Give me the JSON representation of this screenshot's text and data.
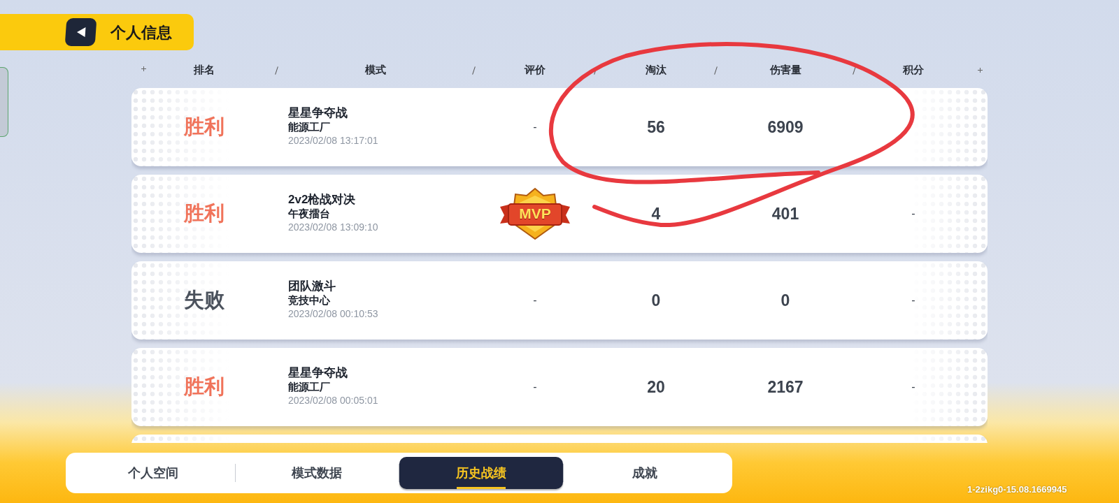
{
  "header": {
    "title": "个人信息"
  },
  "columns": [
    "排名",
    "模式",
    "评价",
    "淘汰",
    "伤害量",
    "积分"
  ],
  "rows": [
    {
      "result": "胜利",
      "kind": "win",
      "mode": "星星争夺战",
      "map": "能源工厂",
      "time": "2023/02/08 13:17:01",
      "rating": {
        "kind": "text",
        "text": "-"
      },
      "eliminations": "56",
      "damage": "6909"
    },
    {
      "result": "胜利",
      "kind": "win",
      "mode": "2v2枪战对决",
      "map": "午夜擂台",
      "time": "2023/02/08 13:09:10",
      "rating": {
        "kind": "badge",
        "text": "MVP"
      },
      "eliminations": "4",
      "damage": "401",
      "points": "-"
    },
    {
      "result": "失败",
      "kind": "loss",
      "mode": "团队激斗",
      "map": "竞技中心",
      "time": "2023/02/08 00:10:53",
      "rating": {
        "kind": "text",
        "text": "-"
      },
      "eliminations": "0",
      "damage": "0",
      "points": "-"
    },
    {
      "result": "胜利",
      "kind": "win",
      "mode": "星星争夺战",
      "map": "能源工厂",
      "time": "2023/02/08 00:05:01",
      "rating": {
        "kind": "text",
        "text": "-"
      },
      "eliminations": "20",
      "damage": "2167",
      "points": "-"
    }
  ],
  "tabs": [
    {
      "label": "个人空间",
      "selected": false
    },
    {
      "label": "模式数据",
      "selected": false
    },
    {
      "label": "历史战绩",
      "selected": true
    },
    {
      "label": "成就",
      "selected": false
    }
  ],
  "version": "1-2zikg0-15.08.1669945"
}
